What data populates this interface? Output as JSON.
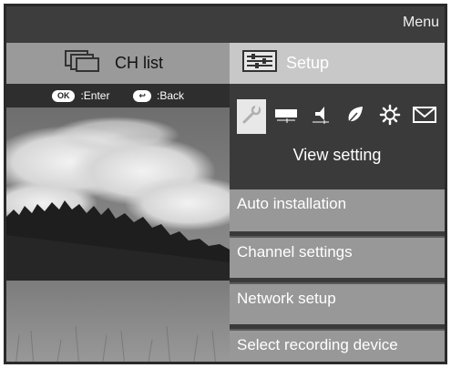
{
  "header": {
    "menu_label": "Menu"
  },
  "tabs": {
    "ch_list": {
      "label": "CH list",
      "icon": "channel-list-icon"
    },
    "setup": {
      "label": "Setup",
      "icon": "setup-sliders-icon"
    }
  },
  "hints": [
    {
      "key": "OK",
      "label": ":Enter",
      "icon": "ok-key-icon"
    },
    {
      "key": "↩",
      "label": ":Back",
      "icon": "back-key-icon"
    }
  ],
  "setup": {
    "category_icons": [
      "wrench-icon",
      "screen-icon",
      "speaker-icon",
      "leaf-icon",
      "sun-gear-icon",
      "envelope-icon"
    ],
    "selected_index": 0,
    "category_title": "View setting",
    "items": [
      {
        "label": "Auto installation"
      },
      {
        "label": "Channel settings"
      },
      {
        "label": "Network setup"
      },
      {
        "label": "Select recording device"
      }
    ]
  },
  "colors": {
    "topbar": "#3d3d3d",
    "tab_chlist": "#9a9a9a",
    "tab_setup": "#c8c8c8",
    "menu_item": "#989898",
    "panel": "#3a3a3a"
  }
}
